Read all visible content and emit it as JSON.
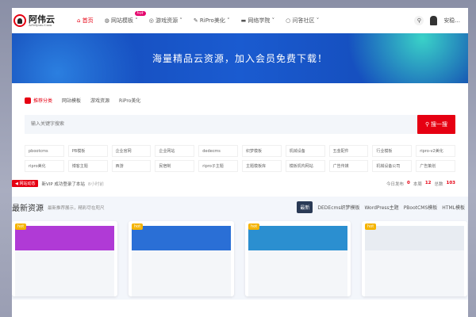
{
  "header": {
    "logo_text": "阿伟云",
    "logo_sub": "AFeiyun.Com",
    "nav": [
      "首页",
      "网站模板",
      "游戏资源",
      "RiPro美化",
      "网络学院",
      "问答社区"
    ],
    "hot_badge": "hot",
    "user": "安稳..."
  },
  "banner": {
    "title": "海量精品云资源，加入会员免费下载！"
  },
  "category_tabs": [
    "推荐分类",
    "网站模板",
    "游戏资源",
    "RiPro美化"
  ],
  "search": {
    "placeholder": "输入关键字搜索",
    "button": "搜一搜"
  },
  "tags": [
    "pbootcms",
    "PB模板",
    "企业官网",
    "企业网站",
    "dedecms",
    "织梦模板",
    "机械设备",
    "五金配件",
    "行业模板",
    "ripro-v2美化",
    "ripro美化",
    "博客主题",
    "西游",
    "民宿制",
    "ripro子主题",
    "主题模板库",
    "模板机构网站",
    "广告传媒",
    "机械设备公司",
    "广告策划"
  ],
  "notice": {
    "badge": "网站动态",
    "text": "新VIP 成功登录了本站",
    "time": "8小时前"
  },
  "stats": {
    "today_label": "今日发布",
    "today": "0",
    "week_label": "本周",
    "week": "12",
    "total_label": "总数",
    "total": "103"
  },
  "latest": {
    "title": "最新资源",
    "desc": "最新推荐展示，精彩尽在咫尺",
    "tabs": [
      "最新",
      "DEDEcms织梦模板",
      "WordPress主题",
      "PBootCMS模板",
      "HTML模板"
    ]
  },
  "cards": [
    {
      "badge": "hot",
      "color": "#b03ad6"
    },
    {
      "badge": "hot",
      "color": "#2a6fd6"
    },
    {
      "badge": "hot",
      "color": "#2b8fd0"
    },
    {
      "badge": "hot",
      "color": "#e8ecf2"
    }
  ]
}
